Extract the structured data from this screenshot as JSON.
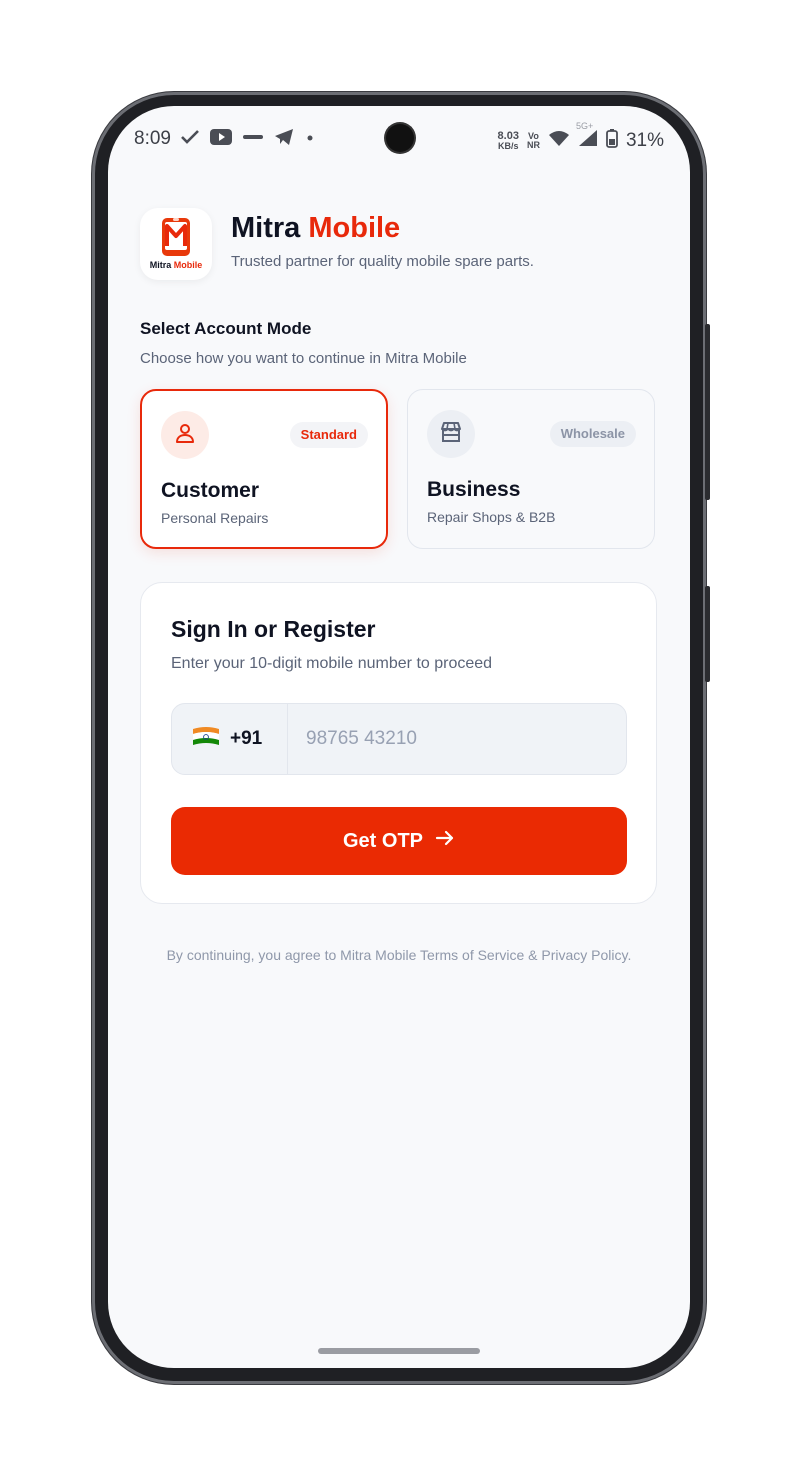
{
  "status_bar": {
    "time": "8:09",
    "net_speed_value": "8.03",
    "net_speed_unit": "KB/s",
    "volte_top": "Vo",
    "volte_bottom": "NR",
    "network_gen": "5G+",
    "battery": "31%"
  },
  "header": {
    "brand_primary": "Mitra",
    "brand_accent": "Mobile",
    "tagline": "Trusted partner for quality mobile spare parts.",
    "logo_text": "Mitra Mobile"
  },
  "account_mode": {
    "title": "Select Account Mode",
    "subtitle": "Choose how you want to continue in Mitra Mobile",
    "options": [
      {
        "badge": "Standard",
        "title": "Customer",
        "subtitle": "Personal Repairs",
        "icon": "user-icon",
        "selected": true
      },
      {
        "badge": "Wholesale",
        "title": "Business",
        "subtitle": "Repair Shops & B2B",
        "icon": "store-icon",
        "selected": false
      }
    ]
  },
  "signin": {
    "title": "Sign In or Register",
    "subtitle": "Enter your 10-digit mobile number to proceed",
    "country_flag": "india-flag-icon",
    "country_code": "+91",
    "phone_value": "",
    "phone_placeholder": "98765 43210",
    "button_label": "Get OTP"
  },
  "terms": "By continuing, you agree to Mitra Mobile Terms of Service & Privacy Policy.",
  "colors": {
    "accent": "#e8290b",
    "button": "#ea2a03",
    "title_text": "#0f1322",
    "muted_text": "#5b6478",
    "background": "#f8f9fb"
  }
}
